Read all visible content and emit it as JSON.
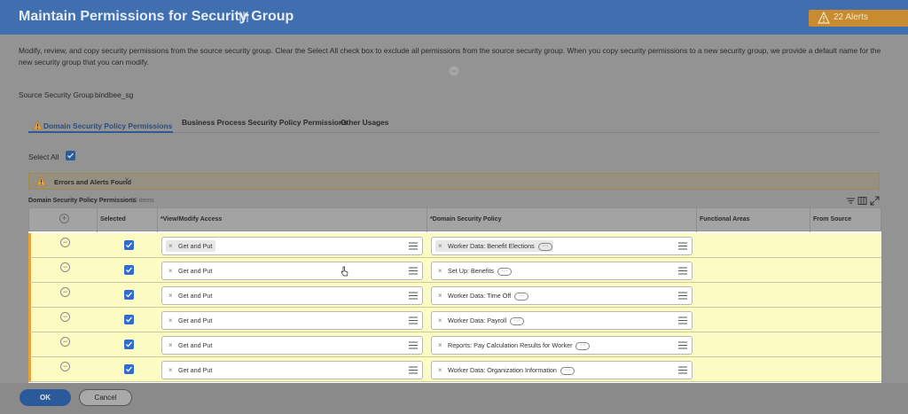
{
  "header": {
    "title": "Maintain Permissions for Security Group",
    "alerts_label": "22 Alerts"
  },
  "description": "Modify, review, and copy security permissions from the source security group. Clear the Select All check box to exclude all permissions from the source security group. When you copy security permissions to a new security group, we provide a default name for the new security group that you can modify.",
  "source": {
    "label": "Source Security Group",
    "value": "bindbee_sg"
  },
  "tabs": [
    {
      "label": "Domain Security Policy Permissions",
      "active": true
    },
    {
      "label": "Business Process Security Policy Permissions",
      "active": false
    },
    {
      "label": "Other Usages",
      "active": false
    }
  ],
  "select_all": {
    "label": "Select All",
    "checked": true
  },
  "errors": {
    "label": "Errors and Alerts Found"
  },
  "table": {
    "caption": "Domain Security Policy Permissions",
    "count": "16 items",
    "columns": {
      "selected": "Selected",
      "access": "*View/Modify Access",
      "policy": "*Domain Security Policy",
      "functional": "Functional Areas",
      "source": "From Source"
    },
    "rows": [
      {
        "access": "Get and Put",
        "policy": "Worker Data: Benefit Elections",
        "checked": true
      },
      {
        "access": "Get and Put",
        "policy": "Set Up: Benefits",
        "checked": true
      },
      {
        "access": "Get and Put",
        "policy": "Worker Data: Time Off",
        "checked": true
      },
      {
        "access": "Get and Put",
        "policy": "Worker Data: Payroll",
        "checked": true
      },
      {
        "access": "Get and Put",
        "policy": "Reports: Pay Calculation Results for Worker",
        "checked": true
      },
      {
        "access": "Get and Put",
        "policy": "Worker Data: Organization Information",
        "checked": true
      }
    ]
  },
  "footer": {
    "ok_label": "OK",
    "cancel_label": "Cancel"
  },
  "colors": {
    "header_bg": "#3f6fae",
    "alerts_bg": "#c98b2f",
    "row_highlight": "#fbfbc2",
    "row_error_border": "#e6a23c",
    "checkbox": "#2f6bd1",
    "primary_button": "#2b5a9a"
  },
  "icons": [
    "filter-icon",
    "warning-icon",
    "add-row-icon",
    "remove-row-icon",
    "prompt-list-icon",
    "checkmark-icon",
    "more-icon",
    "pointer-cursor-icon"
  ]
}
